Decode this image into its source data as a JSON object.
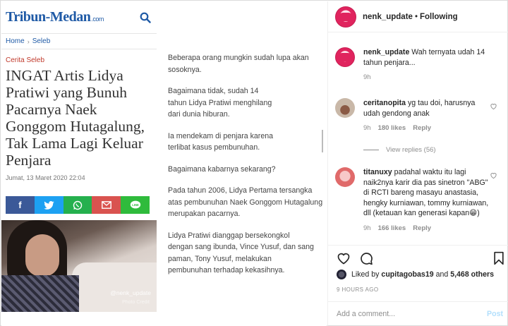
{
  "news": {
    "logo": "Tribun-Medan",
    "logo_suffix": ".com",
    "breadcrumb": [
      "Home",
      "Seleb"
    ],
    "kicker": "Cerita Seleb",
    "headline": "INGAT Artis Lidya Pratiwi yang Bunuh Pacarnya Naek Gonggom Hutagalung, Tak Lama Lagi Keluar Penjara",
    "date": "Jumat, 13 Maret 2020 22:04",
    "photo_watermark": "@nenk_update",
    "photo_watermark2": "Photo Credit",
    "article": [
      "Beberapa orang mungkin sudah lupa akan",
      "sosoknya.",
      "Bagaimana tidak, sudah 14",
      "tahun Lidya Pratiwi menghilang",
      "dari dunia hiburan.",
      "Ia mendekam di penjara karena",
      "terlibat kasus pembunuhan.",
      "Bagaimana kabarnya sekarang?",
      "Pada tahun 2006, Lidya Pertama tersangka",
      "atas pembunuhan Naek Gonggom Hutagalung",
      "merupakan pacarnya.",
      "Lidya Pratiwi dianggap bersekongkol",
      "dengan sang ibunda, Vince Yusuf, dan sang",
      "paman, Tony Yusuf, melakukan",
      "pembunuhan terhadap kekasihnya."
    ]
  },
  "post": {
    "username": "nenk_update",
    "follow_status": "Following",
    "caption_user": "nenk_update",
    "caption_text": "Wah ternyata udah 14 tahun penjara...",
    "caption_time": "9h",
    "comments": [
      {
        "user": "ceritanopita",
        "text": "yg tau doi, harusnya udah gendong anak",
        "time": "9h",
        "likes": "180 likes",
        "reply": "Reply",
        "view_replies": "View replies (56)"
      },
      {
        "user": "titanuxy",
        "text": "padahal waktu itu lagi naik2nya karir dia pas sinetron \"ABG\" di RCTI bareng masayu anastasia, hengky kurniawan, tommy kurniawan, dll (ketauan kan generasi kapan😁)",
        "time": "9h",
        "likes": "166 likes",
        "reply": "Reply"
      }
    ],
    "liked_by_prefix": "Liked by",
    "liked_by_user": "cupitagobas19",
    "liked_by_and": "and",
    "liked_by_count": "5,468 others",
    "posted_ago": "9 HOURS AGO",
    "add_comment_placeholder": "Add a comment...",
    "post_button": "Post"
  }
}
